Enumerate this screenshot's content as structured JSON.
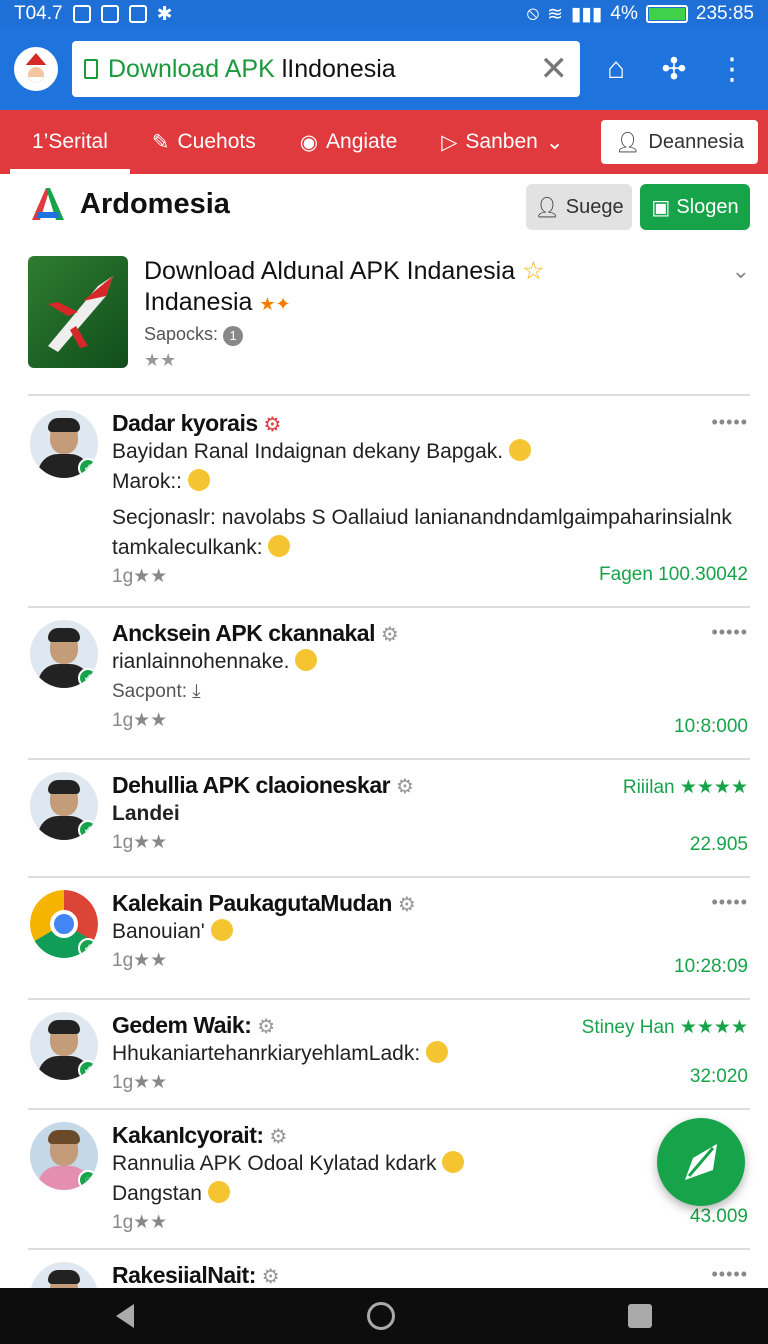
{
  "status": {
    "time": "T04.7",
    "battery": "4%",
    "clock": "235:85",
    "battery_level": 0.95
  },
  "appbar": {
    "url_prefix": "Download APK ",
    "url_rest": "lIndonesia"
  },
  "tabs": [
    {
      "label": "1’Serital",
      "icon": "",
      "active": true
    },
    {
      "label": "Cuehots",
      "icon": "tag-icon"
    },
    {
      "label": "Angiate",
      "icon": "chat-icon"
    },
    {
      "label": "Sanben",
      "icon": "play-icon",
      "dropdown": true
    }
  ],
  "tab_button": {
    "label": "Deannesia",
    "icon": "user-icon"
  },
  "brand": {
    "title": "Ardomesia"
  },
  "buttons": {
    "gray_label": "Suege",
    "green_label": "Slogen"
  },
  "app": {
    "title_line1": "Download Aldunal APK Indanesia",
    "title_line2": "Indanesia",
    "sub": "Sapocks:",
    "sub_badge": "1",
    "stars": "★★"
  },
  "feed": [
    {
      "name": "Dadar kyorais",
      "lines": [
        "Bayidan Ranal Indaignan dekany Bapgak.",
        "Marok::",
        "Secjonaslr: navolabs S Oallaiud lanianandndamlgaimpaharinsialnk",
        "tamkaleculkank:"
      ],
      "meta": "1g★★",
      "value": "Fagen 100.30042",
      "avatar": "person"
    },
    {
      "name": "Ancksein APK ckannakal",
      "lines": [
        "rianlainnohennake.",
        "Sacpont:"
      ],
      "meta": "1g★★",
      "value": "10:8:000",
      "avatar": "person"
    },
    {
      "name": "Dehullia APK claoioneskar",
      "lines": [
        "Landei"
      ],
      "meta": "1g★★",
      "right_top": "Riiilan ★★★★",
      "value": "22.905",
      "avatar": "person"
    },
    {
      "name": "Kalekain PaukagutaMudan",
      "lines": [
        "Banouian'"
      ],
      "meta": "1g★★",
      "value": "10:28:09",
      "avatar": "chrome"
    },
    {
      "name": "Gedem Waik:",
      "lines": [
        "HhukaniartehanrkiaryehlamLadk:"
      ],
      "meta": "1g★★",
      "right_top": "Stiney Han ★★★★",
      "value": "32:020",
      "avatar": "person"
    },
    {
      "name": "KakanIcyorait:",
      "lines": [
        "Rannulia APK Odoal Kylatad kdark",
        "Dangstan"
      ],
      "meta": "1g★★",
      "value": "43.009",
      "avatar": "person"
    },
    {
      "name": "RakesiialNait:",
      "lines": [],
      "meta": "",
      "value": "",
      "avatar": "person"
    }
  ],
  "colors": {
    "appbar": "#1e73dc",
    "tabbar": "#e0393e",
    "accent_green": "#17a34a"
  }
}
